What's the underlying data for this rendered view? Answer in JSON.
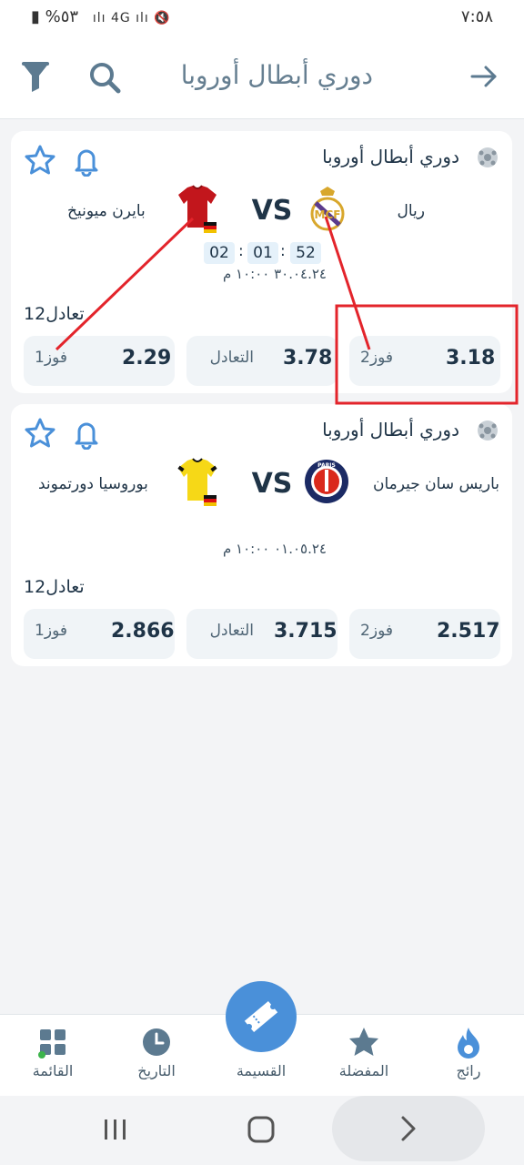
{
  "status": {
    "left": "%٥٣",
    "time": "٧:٥٨"
  },
  "header": {
    "title": "دوري أبطال أوروبا"
  },
  "matches": [
    {
      "league": "دوري أبطال أوروبا",
      "home": "ريال",
      "away": "بايرن ميونيخ",
      "vs": "VS",
      "countdown": [
        "52",
        "01",
        "02"
      ],
      "datetime": "٣٠.٠٤.٢٤ ١٠:٠٠ م",
      "market": "1تعادل2",
      "odds": [
        {
          "label": "فوز2",
          "value": "3.18"
        },
        {
          "label": "التعادل",
          "value": "3.78"
        },
        {
          "label": "فوز1",
          "value": "2.29"
        }
      ]
    },
    {
      "league": "دوري أبطال أوروبا",
      "home": "باريس سان جيرمان",
      "away": "بوروسيا دورتموند",
      "vs": "VS",
      "datetime": "٠١.٠٥.٢٤ ١٠:٠٠ م",
      "market": "1تعادل2",
      "odds": [
        {
          "label": "فوز2",
          "value": "2.517"
        },
        {
          "label": "التعادل",
          "value": "3.715"
        },
        {
          "label": "فوز1",
          "value": "2.866"
        }
      ]
    }
  ],
  "nav": [
    {
      "label": "رائج",
      "icon": "flame-icon"
    },
    {
      "label": "المفضلة",
      "icon": "star-icon"
    },
    {
      "label": "القسيمة",
      "icon": "ticket-icon"
    },
    {
      "label": "التاريخ",
      "icon": "clock-icon"
    },
    {
      "label": "القائمة",
      "icon": "grid-icon"
    }
  ],
  "colors": {
    "accent": "#4a90d9",
    "text": "#1f3447",
    "highlight": "#e3242b"
  }
}
